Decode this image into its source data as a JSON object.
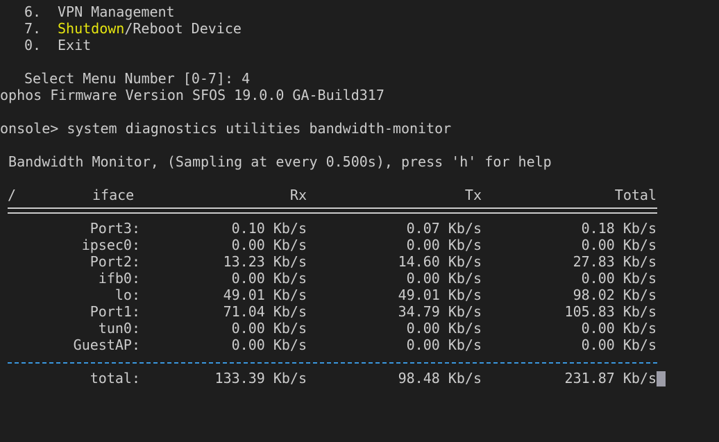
{
  "menu": {
    "item6": {
      "num": "6.",
      "label": "VPN Management"
    },
    "item7": {
      "num": "7.",
      "label_highlight": "Shutdown",
      "label_rest": "/Reboot Device"
    },
    "item0": {
      "num": "0.",
      "label": "Exit"
    },
    "prompt": "Select Menu Number [0-7]: 4"
  },
  "firmware_line": "ophos Firmware Version SFOS 19.0.0 GA-Build317",
  "command_line": "onsole> system diagnostics utilities bandwidth-monitor",
  "monitor_banner": " Bandwidth Monitor, (Sampling at every 0.500s), press 'h' for help",
  "table": {
    "headers": {
      "spinner": "/",
      "iface": "iface",
      "rx": "Rx",
      "tx": "Tx",
      "total": "Total"
    },
    "rows": [
      {
        "iface": "Port3:",
        "rx": "0.10 Kb/s",
        "tx": "0.07 Kb/s",
        "total": "0.18 Kb/s"
      },
      {
        "iface": "ipsec0:",
        "rx": "0.00 Kb/s",
        "tx": "0.00 Kb/s",
        "total": "0.00 Kb/s"
      },
      {
        "iface": "Port2:",
        "rx": "13.23 Kb/s",
        "tx": "14.60 Kb/s",
        "total": "27.83 Kb/s"
      },
      {
        "iface": "ifb0:",
        "rx": "0.00 Kb/s",
        "tx": "0.00 Kb/s",
        "total": "0.00 Kb/s"
      },
      {
        "iface": "lo:",
        "rx": "49.01 Kb/s",
        "tx": "49.01 Kb/s",
        "total": "98.02 Kb/s"
      },
      {
        "iface": "Port1:",
        "rx": "71.04 Kb/s",
        "tx": "34.79 Kb/s",
        "total": "105.83 Kb/s"
      },
      {
        "iface": "tun0:",
        "rx": "0.00 Kb/s",
        "tx": "0.00 Kb/s",
        "total": "0.00 Kb/s"
      },
      {
        "iface": "GuestAP:",
        "rx": "0.00 Kb/s",
        "tx": "0.00 Kb/s",
        "total": "0.00 Kb/s"
      }
    ],
    "total_row": {
      "label": "total:",
      "rx": "133.39 Kb/s",
      "tx": "98.48 Kb/s",
      "total": "231.87 Kb/s"
    }
  },
  "colors": {
    "background": "#1e1e1e",
    "foreground": "#cccccc",
    "highlight": "#e5e510",
    "dash_rule": "#3a96dd",
    "cursor": "#9d9da8"
  }
}
